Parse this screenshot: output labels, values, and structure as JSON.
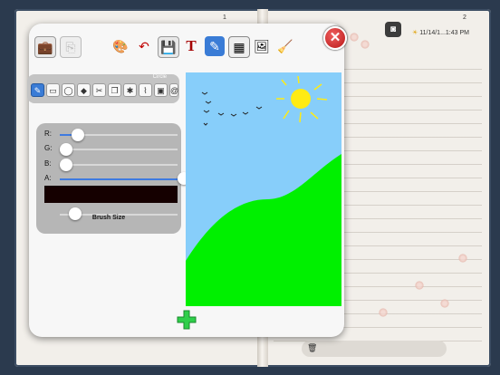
{
  "book": {
    "left_page_number": "1",
    "right_page_number": "2"
  },
  "status": {
    "datetime": "11/14/1...1:43 PM"
  },
  "toolbar": {
    "icons": [
      "briefcase-icon",
      "copy-icon",
      "palette-icon",
      "undo-icon",
      "save-icon",
      "text-icon",
      "pen-icon",
      "grid-icon",
      "photos-icon",
      "cleanup-icon"
    ],
    "close_symbol": "✕"
  },
  "tools": {
    "title": "Circle",
    "items": [
      "pencil",
      "rectangle",
      "ellipse",
      "fill",
      "cut",
      "paste",
      "stamp",
      "brush",
      "monitor",
      "spiral"
    ]
  },
  "color": {
    "labels": {
      "r": "R:",
      "g": "G:",
      "b": "B:",
      "a": "A:"
    },
    "values": {
      "r": 0.1,
      "g": 0.0,
      "b": 0.0,
      "a": 1.0
    },
    "swatch": "#150000",
    "brush_size_label": "Brush Size",
    "brush_size_value": 0.08
  },
  "canvas": {
    "sky": "#87cefa",
    "grass": "#00f000",
    "sun": "#ffeb14",
    "birds": "#222"
  },
  "add_symbol": "+"
}
